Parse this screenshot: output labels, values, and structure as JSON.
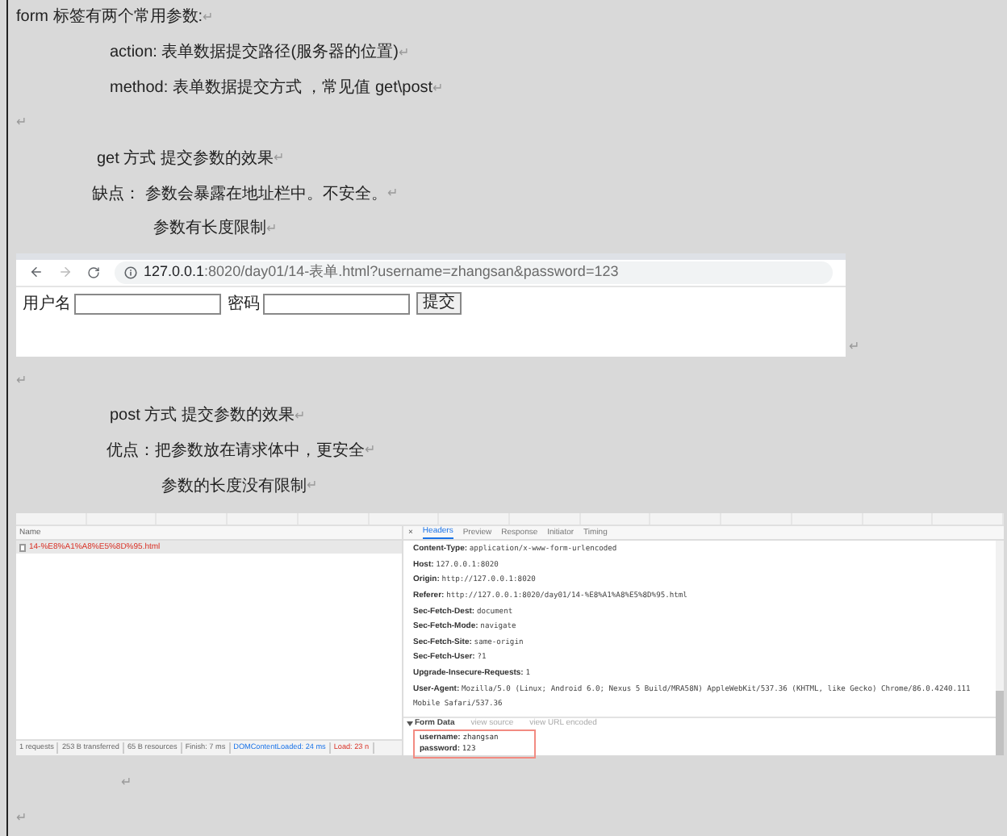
{
  "paragraphs_top": [
    {
      "text": "form  标签有两个常用参数:",
      "mark": "↵"
    },
    {
      "text": "action:   表单数据提交路径(服务器的位置)",
      "mark": "↵"
    },
    {
      "text": "method: 表单数据提交方式 ，常见值  get\\post",
      "mark": "↵"
    },
    {
      "mark": "↵"
    },
    {
      "text": "get  方式  提交参数的效果",
      "mark": "↵"
    },
    {
      "text": "缺点：  参数会暴露在地址栏中。不安全。",
      "mark": "↵"
    },
    {
      "text": "参数有长度限制",
      "mark": "↵"
    }
  ],
  "browser_shot": {
    "url_host": "127.0.0.1",
    "url_rest": ":8020/day01/14-表单.html?username=zhangsan&password=123",
    "fields": [
      {
        "label": "用户名"
      },
      {
        "label": "密码"
      }
    ],
    "submit": "提交",
    "mark": "↵"
  },
  "paragraphs_middle": [
    {
      "mark": "↵"
    },
    {
      "text": "post  方式  提交参数的效果",
      "mark": "↵"
    },
    {
      "text": "优点：把参数放在请求体中，更安全",
      "mark": "↵"
    },
    {
      "text": "参数的长度没有限制",
      "mark": "↵"
    }
  ],
  "devtools_shot": {
    "name_header": "Name",
    "request": "14-%E8%A1%A8%E5%8D%95.html",
    "status_items": [
      {
        "text": "1 requests",
        "kind": "plain"
      },
      {
        "text": "253 B transferred",
        "kind": "plain"
      },
      {
        "text": "65 B resources",
        "kind": "plain"
      },
      {
        "text": "Finish: 7 ms",
        "kind": "plain"
      },
      {
        "text": "DOMContentLoaded: 24 ms",
        "kind": "dom"
      },
      {
        "text": "Load: 23 n",
        "kind": "load"
      }
    ],
    "close": "×",
    "tabs": [
      {
        "label": "Headers",
        "selected": true
      },
      {
        "label": "Preview",
        "selected": false
      },
      {
        "label": "Response",
        "selected": false
      },
      {
        "label": "Initiator",
        "selected": false
      },
      {
        "label": "Timing",
        "selected": false
      }
    ],
    "headers": [
      {
        "name": "Content-Type:",
        "value": "application/x-www-form-urlencoded"
      },
      {
        "name": "Host:",
        "value": "127.0.0.1:8020"
      },
      {
        "name": "Origin:",
        "value": "http://127.0.0.1:8020"
      },
      {
        "name": "Referer:",
        "value": "http://127.0.0.1:8020/day01/14-%E8%A1%A8%E5%8D%95.html"
      },
      {
        "name": "Sec-Fetch-Dest:",
        "value": "document"
      },
      {
        "name": "Sec-Fetch-Mode:",
        "value": "navigate"
      },
      {
        "name": "Sec-Fetch-Site:",
        "value": "same-origin"
      },
      {
        "name": "Sec-Fetch-User:",
        "value": "?1"
      },
      {
        "name": "Upgrade-Insecure-Requests:",
        "value": "1"
      },
      {
        "name": "User-Agent:",
        "value": "Mozilla/5.0 (Linux; Android 6.0; Nexus 5 Build/MRA58N) AppleWebKit/537.36 (KHTML, like Gecko) Chrome/86.0.4240.111 Mobile Safari/537.36"
      }
    ],
    "form_data": {
      "title": "Form Data",
      "links": [
        "view source",
        "view URL encoded"
      ],
      "rows": [
        {
          "name": "username:",
          "value": "zhangsan"
        },
        {
          "name": "password:",
          "value": "123"
        }
      ]
    }
  },
  "paragraphs_bottom": [
    {
      "mark": "↵"
    },
    {
      "mark": "↵"
    }
  ]
}
